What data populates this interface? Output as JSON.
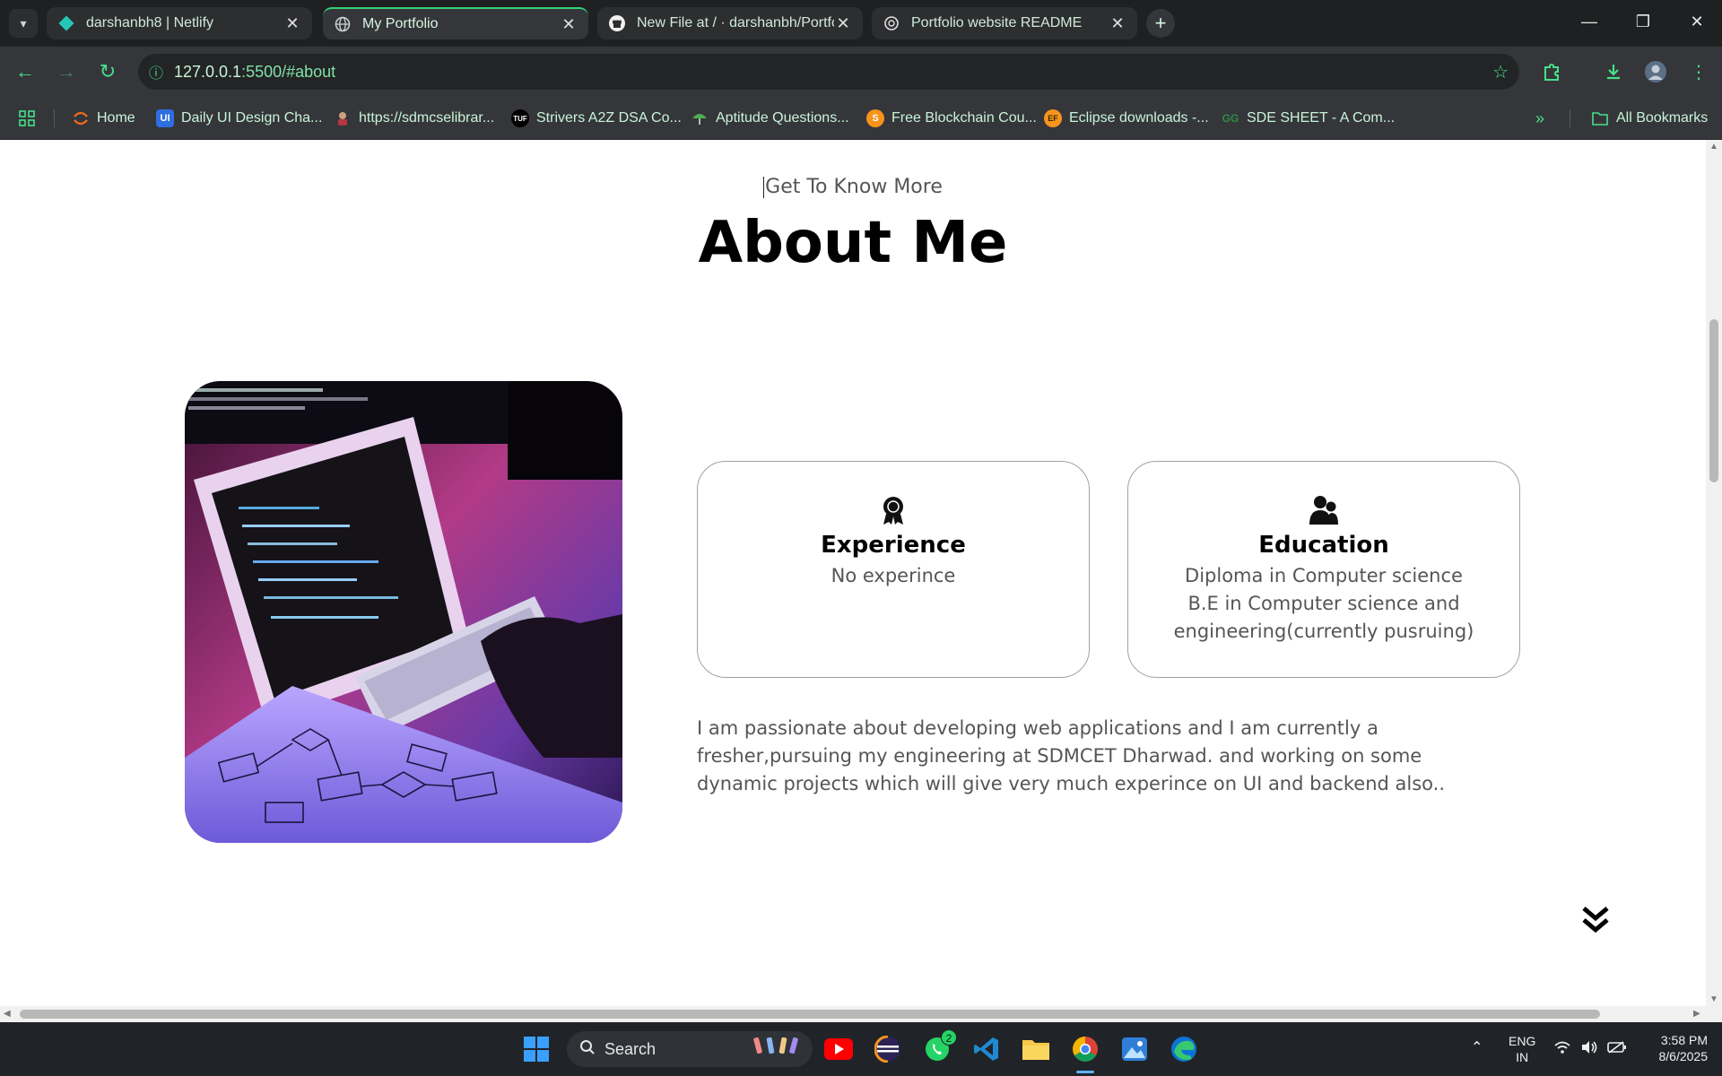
{
  "browser": {
    "tabs": [
      {
        "label": "darshanbh8 | Netlify",
        "icon": "netlify-icon"
      },
      {
        "label": "My Portfolio",
        "icon": "globe-icon"
      },
      {
        "label": "New File at / · darshanbh/Portfo",
        "icon": "github-icon"
      },
      {
        "label": "Portfolio website README",
        "icon": "openai-icon"
      }
    ],
    "url_host": "127.0.0.1",
    "url_rest": ":5500/#about",
    "bookmarks": [
      {
        "label": "Home",
        "icon": "home-arc-icon",
        "color": "#f26b1d"
      },
      {
        "label": "Daily UI Design Cha...",
        "icon": "ui-icon",
        "color": "#2f6de1"
      },
      {
        "label": "https://sdmcselibrar...",
        "icon": "person-icon",
        "color": "#c9a27e"
      },
      {
        "label": "Strivers A2Z DSA Co...",
        "icon": "tuf-icon",
        "color": "#000000"
      },
      {
        "label": "Aptitude Questions...",
        "icon": "umbrella-icon",
        "color": "#4caf50"
      },
      {
        "label": "Free Blockchain Cou...",
        "icon": "s-icon",
        "color": "#f7931a"
      },
      {
        "label": "Eclipse downloads -...",
        "icon": "ef-icon",
        "color": "#f7941d"
      },
      {
        "label": "SDE SHEET - A Com...",
        "icon": "gfg-icon",
        "color": "#2f8d46"
      }
    ],
    "all_bookmarks": "All Bookmarks"
  },
  "about": {
    "subtitle": "Get To Know More",
    "title": "About Me",
    "experience": {
      "title": "Experience",
      "text": "No experince"
    },
    "education": {
      "title": "Education",
      "line1": "Diploma in Computer science",
      "line2": "B.E in Computer science and",
      "line3": "engineering(currently pusruing)"
    },
    "bio": "I am passionate about developing web applications and I am currently a fresher,pursuing my engineering at SDMCET Dharwad. and working on some dynamic projects which will give very much experince on UI and backend also.."
  },
  "taskbar": {
    "search_label": "Search",
    "whatsapp_badge": "2",
    "lang1": "ENG",
    "lang2": "IN",
    "time": "3:58 PM",
    "date": "8/6/2025"
  }
}
